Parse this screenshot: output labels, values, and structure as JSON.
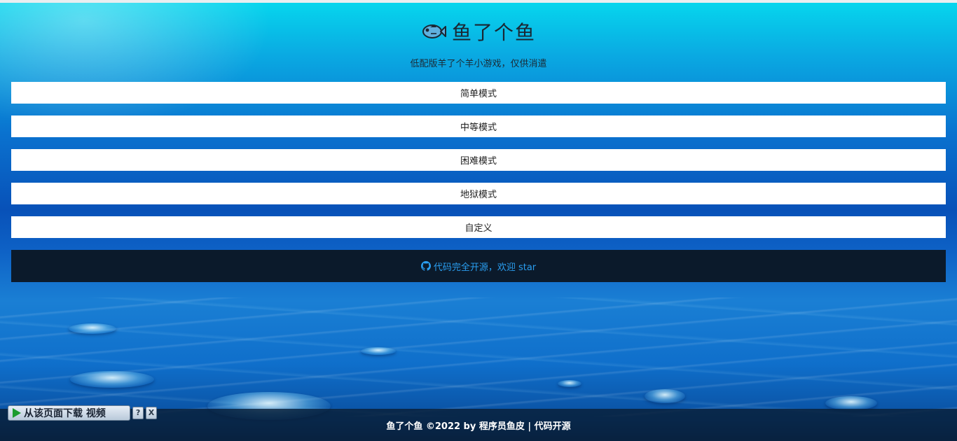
{
  "header": {
    "title": "鱼了个鱼",
    "icon": "fish-icon",
    "subtitle": "低配版羊了个羊小游戏，仅供消遣"
  },
  "modes": [
    {
      "label": "简单模式"
    },
    {
      "label": "中等模式"
    },
    {
      "label": "困难模式"
    },
    {
      "label": "地狱模式"
    },
    {
      "label": "自定义"
    }
  ],
  "github": {
    "icon": "github-icon",
    "label": "代码完全开源，欢迎 star",
    "color": "#2a9ef0"
  },
  "footer": {
    "text": "鱼了个鱼 ©2022 by 程序员鱼皮 | 代码开源"
  },
  "download_bar": {
    "label": "从该页面下载 视频",
    "help": "?",
    "close": "X"
  },
  "colors": {
    "panel": "#0b1a2b",
    "button_bg": "#ffffff"
  }
}
